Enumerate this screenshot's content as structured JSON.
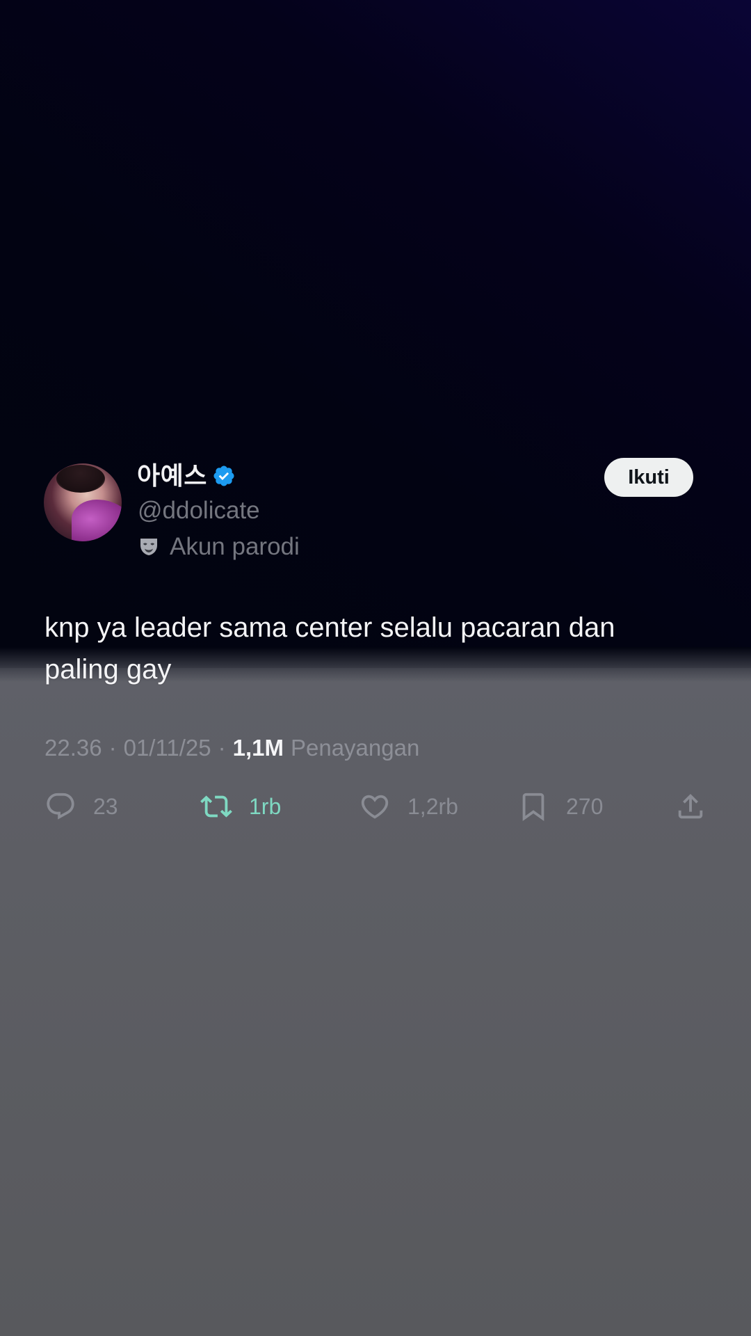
{
  "user": {
    "display_name": "아예스",
    "handle": "@ddolicate",
    "parody_label": "Akun parodi",
    "follow_label": "Ikuti"
  },
  "tweet": {
    "text_line1": "knp ya leader sama center selalu pacaran dan",
    "text_line2": "paling gay"
  },
  "meta": {
    "time": "22.36",
    "separator": "·",
    "date": "01/11/25",
    "views_count": "1,1M",
    "views_label": "Penayangan"
  },
  "actions": {
    "reply_count": "23",
    "retweet_count": "1rb",
    "like_count": "1,2rb",
    "bookmark_count": "270"
  },
  "colors": {
    "verified": "#1d9bf0",
    "retweet_active": "#7fd9c2",
    "follow_button_bg": "#eef0f0"
  },
  "icons": [
    "verified-badge-icon",
    "parody-mask-icon",
    "reply-icon",
    "retweet-icon",
    "like-icon",
    "bookmark-icon",
    "share-icon"
  ]
}
